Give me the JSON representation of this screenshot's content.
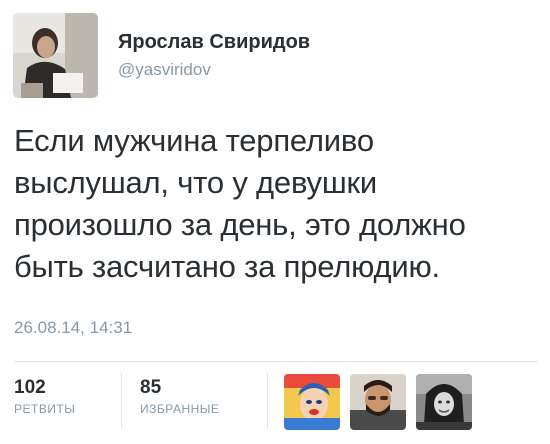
{
  "tweet": {
    "author_name": "Ярослав Свиридов",
    "author_handle": "@yasviridov",
    "lines": [
      "Если мужчина терпеливо",
      "выслушал, что у девушки",
      "произошло за день, это должно",
      "быть засчитано за прелюдию."
    ],
    "timestamp": "26.08.14, 14:31"
  },
  "stats": {
    "retweets_count": "102",
    "retweets_label": "РЕТВИТЫ",
    "favorites_count": "85",
    "favorites_label": "ИЗБРАННЫЕ"
  },
  "favoriters": [
    "avatar-popart",
    "avatar-man-beard",
    "avatar-woman-bw"
  ],
  "colors": {
    "text": "#292f33",
    "secondary": "#8899a6",
    "divider": "#e1e8ed"
  }
}
